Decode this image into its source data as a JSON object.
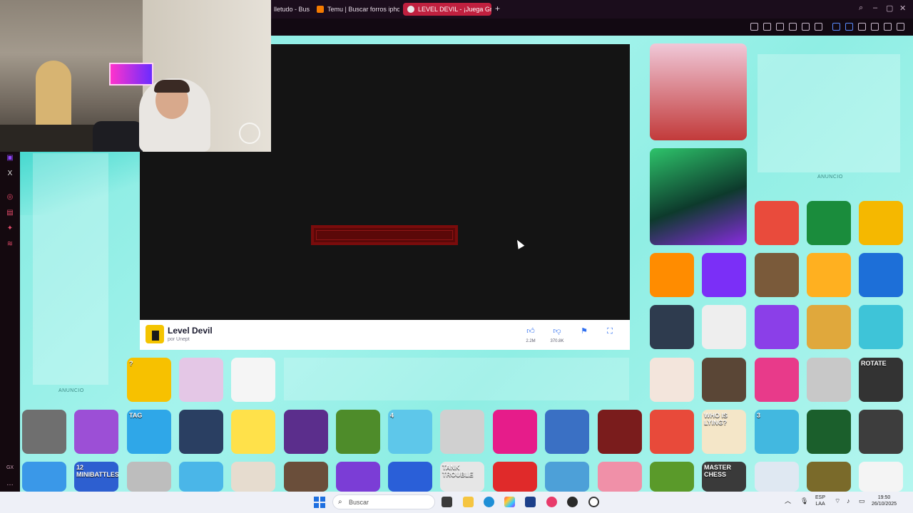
{
  "browser": {
    "tabs": [
      {
        "label": "lletudo - Bus",
        "fav": "#d63b3b"
      },
      {
        "label": "Temu | Buscar forros iphc",
        "fav": "#f57b00"
      },
      {
        "label": "LEVEL DEVIL - ¡Juega Gr",
        "fav": "#e8e8e8",
        "active": true
      }
    ],
    "new_tab": "+"
  },
  "game": {
    "title": "Level Devil",
    "author": "por Unept",
    "likes": "2.2M",
    "dislikes": "370.8K",
    "like_icon": "thumbs-up-icon",
    "dislike_icon": "thumbs-down-icon",
    "report_icon": "flag-icon",
    "fullscreen_icon": "fullscreen-icon"
  },
  "ads": {
    "label_left": "ANUNCIO",
    "label_right": "ANUNCIO"
  },
  "thumbnails": [
    {
      "label": "",
      "bg": "#e94b3c"
    },
    {
      "label": "",
      "bg": "#1a8c3c"
    },
    {
      "label": "",
      "bg": "#f5b800"
    },
    {
      "label": "",
      "bg": "#ff8c00"
    },
    {
      "label": "",
      "bg": "#7b2ff7"
    },
    {
      "label": "",
      "bg": "#7a5a3a"
    },
    {
      "label": "",
      "bg": "#ffb020"
    },
    {
      "label": "",
      "bg": "#1d6fd8"
    },
    {
      "label": "",
      "bg": "#2e3b4e"
    },
    {
      "label": "",
      "bg": "#eeeeee"
    },
    {
      "label": "",
      "bg": "#8b3fe8"
    },
    {
      "label": "",
      "bg": "#e0a83c"
    },
    {
      "label": "",
      "bg": "#3ec4d8"
    },
    {
      "label": "",
      "bg": "#f3e5dc"
    },
    {
      "label": "",
      "bg": "#5a4636"
    },
    {
      "label": "",
      "bg": "#e83a8a"
    },
    {
      "label": "",
      "bg": "#c8c8c8"
    },
    {
      "label": "ROTATE",
      "bg": "#333333"
    },
    {
      "label": "?",
      "bg": "#f7c100"
    },
    {
      "label": "",
      "bg": "#e4c7e6"
    },
    {
      "label": "",
      "bg": "#f5f5f5"
    },
    {
      "label": "",
      "bg": "#6f6f6f"
    },
    {
      "label": "",
      "bg": "#9c4fd6"
    },
    {
      "label": "TAG",
      "bg": "#2fa7e8"
    },
    {
      "label": "",
      "bg": "#2a3f62"
    },
    {
      "label": "",
      "bg": "#ffe14a"
    },
    {
      "label": "",
      "bg": "#5b2e8c"
    },
    {
      "label": "",
      "bg": "#4e8c2a"
    },
    {
      "label": "4",
      "bg": "#5ec7ea"
    },
    {
      "label": "",
      "bg": "#d0d0d0"
    },
    {
      "label": "",
      "bg": "#e61c8a"
    },
    {
      "label": "",
      "bg": "#3a70c4"
    },
    {
      "label": "",
      "bg": "#7a1c1c"
    },
    {
      "label": "",
      "bg": "#e84a3a"
    },
    {
      "label": "WHO IS LYING?",
      "bg": "#f4e6c8"
    },
    {
      "label": "3",
      "bg": "#42b8e0"
    },
    {
      "label": "",
      "bg": "#1b5f2c"
    },
    {
      "label": "",
      "bg": "#3d3d3d"
    },
    {
      "label": "",
      "bg": "#3a98e8"
    },
    {
      "label": "12 MINIBATTLES",
      "bg": "#2d5fd0"
    },
    {
      "label": "",
      "bg": "#bdbdbd"
    },
    {
      "label": "",
      "bg": "#4ab6e8"
    },
    {
      "label": "",
      "bg": "#e6dccf"
    },
    {
      "label": "",
      "bg": "#6a4e3a"
    },
    {
      "label": "",
      "bg": "#7b3dd6"
    },
    {
      "label": "",
      "bg": "#2a5fd8"
    },
    {
      "label": "TANK TROUBLE",
      "bg": "#e6e6e6"
    },
    {
      "label": "",
      "bg": "#e02a2a"
    },
    {
      "label": "",
      "bg": "#4da0d8"
    },
    {
      "label": "",
      "bg": "#f090a8"
    },
    {
      "label": "",
      "bg": "#5a9a2a"
    },
    {
      "label": "MASTER CHESS",
      "bg": "#3a3a3a"
    },
    {
      "label": "",
      "bg": "#dfe8f2"
    },
    {
      "label": "",
      "bg": "#7a6a2a"
    },
    {
      "label": "",
      "bg": "#f4f4f4"
    },
    {
      "label": "",
      "bg": "#c01c1c"
    }
  ],
  "taskbar": {
    "search_placeholder": "Buscar",
    "lang_top": "ESP",
    "lang_bottom": "LAA",
    "time": "19:50",
    "date": "26/10/2025"
  }
}
